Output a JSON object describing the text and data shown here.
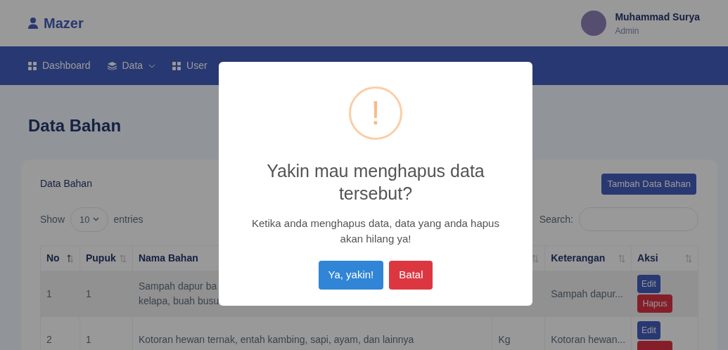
{
  "header": {
    "brand": "Mazer",
    "user": {
      "name": "Muhammad Surya",
      "role": "Admin"
    }
  },
  "nav": [
    {
      "label": "Dashboard",
      "kind": "grid",
      "dropdown": false
    },
    {
      "label": "Data",
      "kind": "layers",
      "dropdown": true
    },
    {
      "label": "User",
      "kind": "grid",
      "dropdown": false
    }
  ],
  "page_title": "Data Bahan",
  "card": {
    "title": "Data Bahan",
    "add_button": "Tambah Data Bahan",
    "show_label": "Show",
    "entries_value": "10",
    "entries_label": "entries",
    "search_label": "Search:"
  },
  "table": {
    "columns": [
      {
        "label": "No",
        "sorted": true
      },
      {
        "label": "Pupuk",
        "sorted": false
      },
      {
        "label": "Nama Bahan"
      },
      {
        "sorted": false
      },
      {
        "label": "Keterangan",
        "sorted": false
      },
      {
        "label": "Aksi",
        "sorted": false
      }
    ],
    "rows": [
      {
        "cells": [
          "1",
          "1",
          [
            "Sampah dapur ba",
            "kelapa, buah busu"
          ],
          "",
          "Sampah dapur..."
        ],
        "actions": [
          {
            "kind": "edit",
            "label": "Edit"
          },
          {
            "kind": "delete",
            "label": "Hapus"
          }
        ]
      },
      {
        "cells": [
          "2",
          "1",
          [
            "Kotoran hewan ternak, entah kambing, sapi, ayam, dan lainnya"
          ],
          "Kg",
          "Kotoran hewan..."
        ],
        "actions": [
          {
            "kind": "edit",
            "label": "Edit"
          },
          {
            "kind": "delete"
          }
        ]
      }
    ]
  },
  "dialog": {
    "icon": "!",
    "title": "Yakin mau menghapus data tersebut?",
    "message": "Ketika anda menghapus data, data yang anda hapus akan hilang ya!",
    "buttons": [
      {
        "label": "Ya, yakin!",
        "kind": "confirm"
      },
      {
        "label": "Batal",
        "kind": "cancel"
      }
    ]
  }
}
